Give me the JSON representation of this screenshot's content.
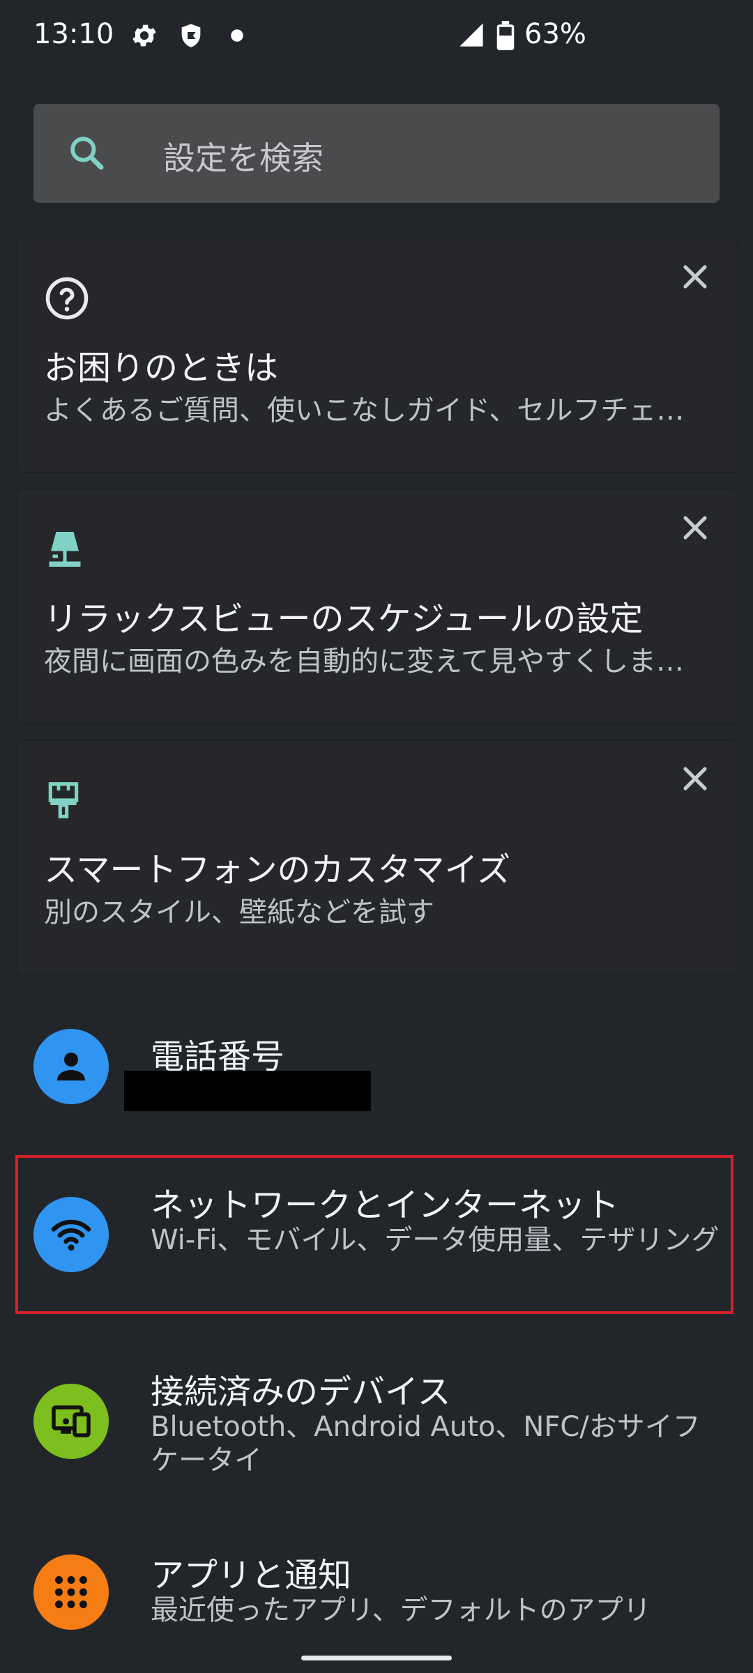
{
  "status_bar": {
    "time": "13:10",
    "battery": "63%",
    "icons": [
      "gear-icon",
      "shield-icon",
      "dot-icon",
      "signal-icon",
      "battery-icon"
    ]
  },
  "search": {
    "placeholder": "設定を検索",
    "icon": "search-icon"
  },
  "suggestion_cards": [
    {
      "icon": "help-circle-icon",
      "title": "お困りのときは",
      "subtitle": "よくあるご質問、使いこなしガイド、セルフチェ…"
    },
    {
      "icon": "lamp-icon",
      "title": "リラックスビューのスケジュールの設定",
      "subtitle": "夜間に画面の色みを自動的に変えて見やすくしま…"
    },
    {
      "icon": "brush-icon",
      "title": "スマートフォンのカスタマイズ",
      "subtitle": "別のスタイル、壁紙などを試す"
    }
  ],
  "settings": [
    {
      "icon": "person-icon",
      "title": "電話番号",
      "subtitle": ""
    },
    {
      "icon": "wifi-icon",
      "title": "ネットワークとインターネット",
      "subtitle": "Wi-Fi、モバイル、データ使用量、テザリング"
    },
    {
      "icon": "devices-icon",
      "title": "接続済みのデバイス",
      "subtitle": "Bluetooth、Android Auto、NFC/おサイフケータイ"
    },
    {
      "icon": "apps-icon",
      "title": "アプリと通知",
      "subtitle": "最近使ったアプリ、デフォルトのアプリ"
    }
  ],
  "colors": {
    "background": "#22262b",
    "accent_teal": "#7fd2c4",
    "blue_icon": "#2f95f0",
    "green_icon": "#7cbf1f",
    "orange_icon": "#f57d14",
    "highlight_border": "#d3202a"
  }
}
